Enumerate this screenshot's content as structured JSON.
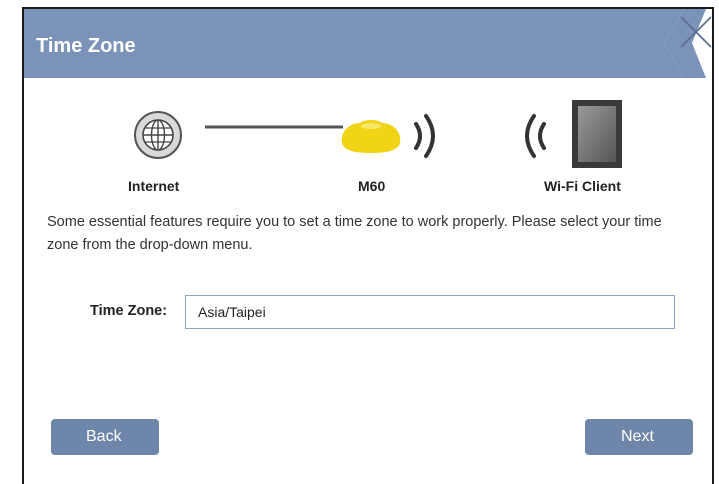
{
  "dialog": {
    "title": "Time Zone",
    "close_icon": "close-icon"
  },
  "diagram": {
    "internet_label": "Internet",
    "device_label": "M60",
    "client_label": "Wi-Fi Client",
    "icons": [
      "globe-icon",
      "connection-line",
      "router-icon",
      "wifi-signal-icon",
      "wifi-signal-icon",
      "tablet-icon"
    ]
  },
  "description": "Some essential features require you to set a time zone to work properly. Please select your time zone from the drop-down menu.",
  "form": {
    "time_zone_label": "Time Zone:",
    "time_zone_value": "Asia/Taipei"
  },
  "buttons": {
    "back": "Back",
    "next": "Next"
  },
  "colors": {
    "title_bar": "#7b93b8",
    "button": "#6e86aa",
    "router_yellow": "#f2d417"
  }
}
